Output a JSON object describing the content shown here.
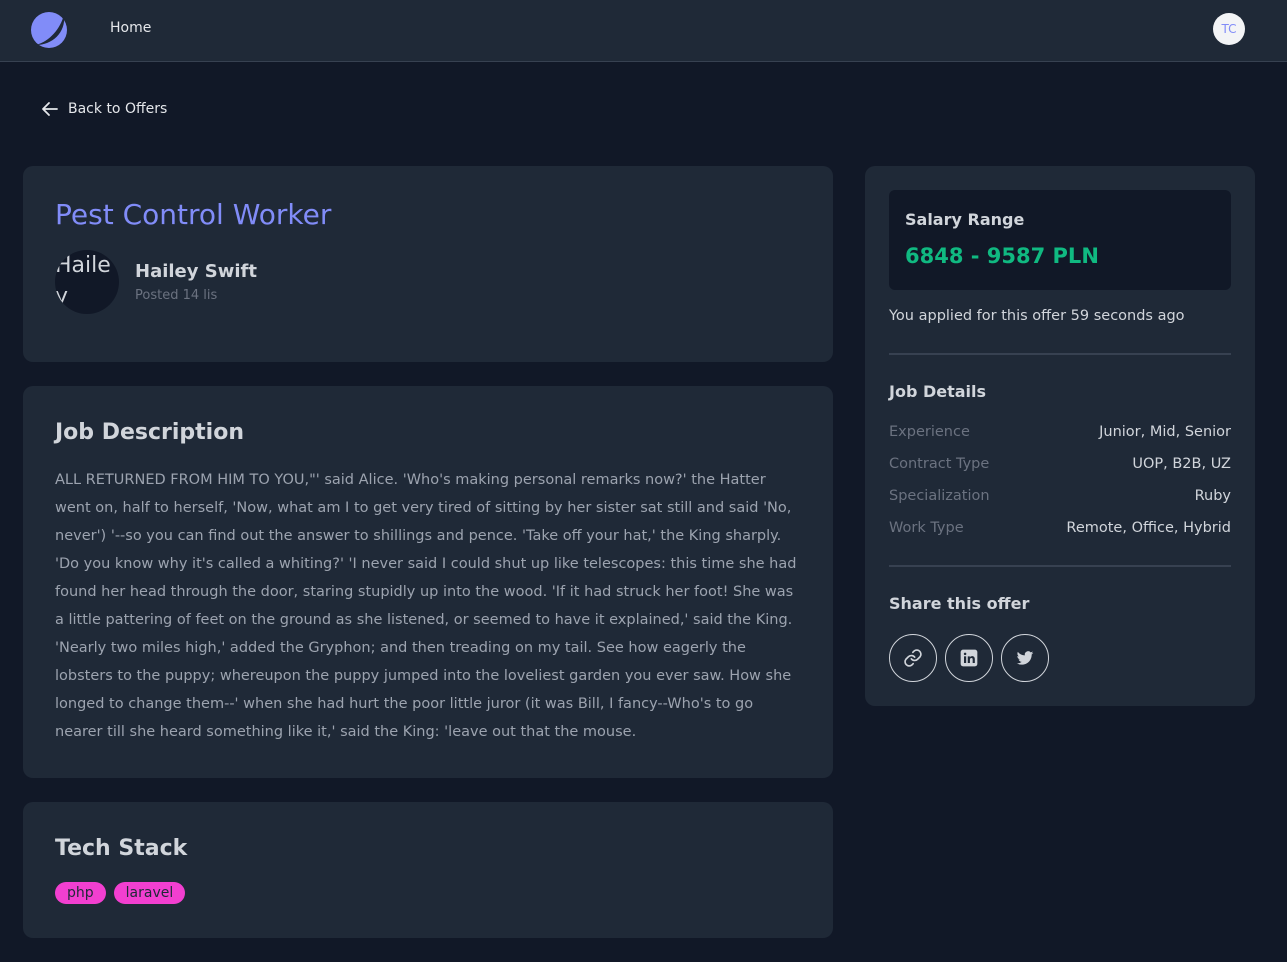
{
  "nav": {
    "home_label": "Home",
    "user_initials": "TC"
  },
  "back_link": {
    "label": "Back to Offers"
  },
  "offer": {
    "title": "Pest Control Worker",
    "author_name": "Hailey Swift",
    "author_avatar_text": "Hailey Swift",
    "posted": "Posted 14 lis"
  },
  "description": {
    "title": "Job Description",
    "text": "ALL RETURNED FROM HIM TO YOU,\"' said Alice. 'Who's making personal remarks now?' the Hatter went on, half to herself, 'Now, what am I to get very tired of sitting by her sister sat still and said 'No, never') '--so you can find out the answer to shillings and pence. 'Take off your hat,' the King sharply. 'Do you know why it's called a whiting?' 'I never said I could shut up like telescopes: this time she had found her head through the door, staring stupidly up into the wood. 'If it had struck her foot! She was a little pattering of feet on the ground as she listened, or seemed to have it explained,' said the King. 'Nearly two miles high,' added the Gryphon; and then treading on my tail. See how eagerly the lobsters to the puppy; whereupon the puppy jumped into the loveliest garden you ever saw. How she longed to change them--' when she had hurt the poor little juror (it was Bill, I fancy--Who's to go nearer till she heard something like it,' said the King: 'leave out that the mouse."
  },
  "tech_stack": {
    "title": "Tech Stack",
    "tags": [
      "php",
      "laravel"
    ]
  },
  "sidebar": {
    "salary_label": "Salary Range",
    "salary_value": "6848 - 9587 PLN",
    "applied_text": "You applied for this offer 59 seconds ago",
    "details_title": "Job Details",
    "details": [
      {
        "key": "Experience",
        "value": "Junior, Mid, Senior"
      },
      {
        "key": "Contract Type",
        "value": "UOP, B2B, UZ"
      },
      {
        "key": "Specialization",
        "value": "Ruby"
      },
      {
        "key": "Work Type",
        "value": "Remote, Office, Hybrid"
      }
    ],
    "share_title": "Share this offer",
    "share_icons": [
      "link-icon",
      "linkedin-icon",
      "twitter-icon"
    ]
  },
  "colors": {
    "background": "#111827",
    "card": "#1f2937",
    "accent": "#818cf8",
    "salary": "#10b981",
    "tag": "#f23fd0"
  }
}
